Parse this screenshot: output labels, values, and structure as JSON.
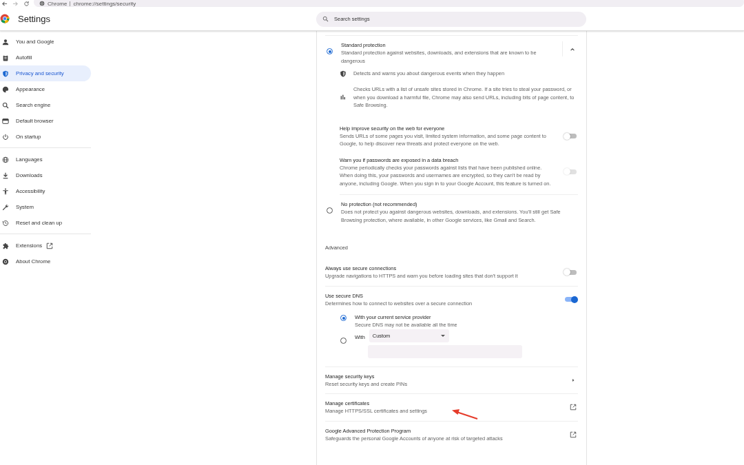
{
  "browser": {
    "site_chip": "Chrome",
    "url": "chrome://settings/security"
  },
  "header": {
    "title": "Settings",
    "search": {
      "placeholder": "Search settings"
    }
  },
  "sidebar": {
    "groups": [
      {
        "items": [
          {
            "kind": "page",
            "label": "You and Google",
            "selected": false
          },
          {
            "kind": "page",
            "label": "Autofill",
            "selected": false
          },
          {
            "kind": "page",
            "label": "Privacy and security",
            "selected": true
          },
          {
            "kind": "page",
            "label": "Appearance",
            "selected": false
          },
          {
            "kind": "page",
            "label": "Search engine",
            "selected": false
          },
          {
            "kind": "page",
            "label": "Default browser",
            "selected": false
          },
          {
            "kind": "page",
            "label": "On startup",
            "selected": false
          }
        ]
      },
      {
        "items": [
          {
            "kind": "page",
            "label": "Languages",
            "selected": false
          },
          {
            "kind": "page",
            "label": "Downloads",
            "selected": false
          },
          {
            "kind": "page",
            "label": "Accessibility",
            "selected": false
          },
          {
            "kind": "page",
            "label": "System",
            "selected": false
          },
          {
            "kind": "page",
            "label": "Reset and clean up",
            "selected": false
          }
        ]
      },
      {
        "items": [
          {
            "kind": "external",
            "label": "Extensions",
            "selected": false
          },
          {
            "kind": "page",
            "label": "About Chrome",
            "selected": false
          }
        ]
      }
    ]
  },
  "protection_options": [
    {
      "title": "Standard protection",
      "description": "Standard protection against websites, downloads, and extensions that are known to be dangerous",
      "selected": true,
      "expanded": true,
      "details": [
        {
          "text": "Detects and warns you about dangerous events when they happen"
        },
        {
          "text": "Checks URLs with a list of unsafe sites stored in Chrome. If a site tries to steal your password, or when you download a harmful file, Chrome may also send URLs, including bits of page content, to Safe Browsing."
        }
      ],
      "settings": [
        {
          "title": "Help improve security on the web for everyone",
          "description": "Sends URLs of some pages you visit, limited system information, and some page content to Google, to help discover new threats and protect everyone on the web.",
          "on": false,
          "disabled": false
        },
        {
          "title": "Warn you if passwords are exposed in a data breach",
          "description": "Chrome periodically checks your passwords against lists that have been published online. When doing this, your passwords and usernames are encrypted, so they can't be read by anyone, including Google. When you sign in to your Google Account, this feature is turned on.",
          "on": false,
          "disabled": true
        }
      ]
    },
    {
      "title": "No protection (not recommended)",
      "description": "Does not protect you against dangerous websites, downloads, and extensions. You'll still get Safe Browsing protection, where available, in other Google services, like Gmail and Search.",
      "selected": false
    }
  ],
  "advanced": {
    "heading": "Advanced",
    "rows": [
      {
        "kind": "toggle",
        "title": "Always use secure connections",
        "description": "Upgrade navigations to HTTPS and warn you before loading sites that don't support it",
        "on": false
      },
      {
        "kind": "dns",
        "title": "Use secure DNS",
        "description": "Determines how to connect to websites over a secure connection",
        "on": true,
        "providers": [
          {
            "label": "With your current service provider",
            "description": "Secure DNS may not be available all the time",
            "selected": true
          },
          {
            "label": "With",
            "selected": false,
            "dropdown": {
              "value": "Custom"
            }
          }
        ]
      },
      {
        "kind": "arrow",
        "title": "Manage security keys",
        "description": "Reset security keys and create PINs"
      },
      {
        "kind": "external",
        "title": "Manage certificates",
        "description": "Manage HTTPS/SSL certificates and settings"
      },
      {
        "kind": "external",
        "title": "Google Advanced Protection Program",
        "description": "Safeguards the personal Google Accounts of anyone at risk of targeted attacks"
      }
    ]
  }
}
